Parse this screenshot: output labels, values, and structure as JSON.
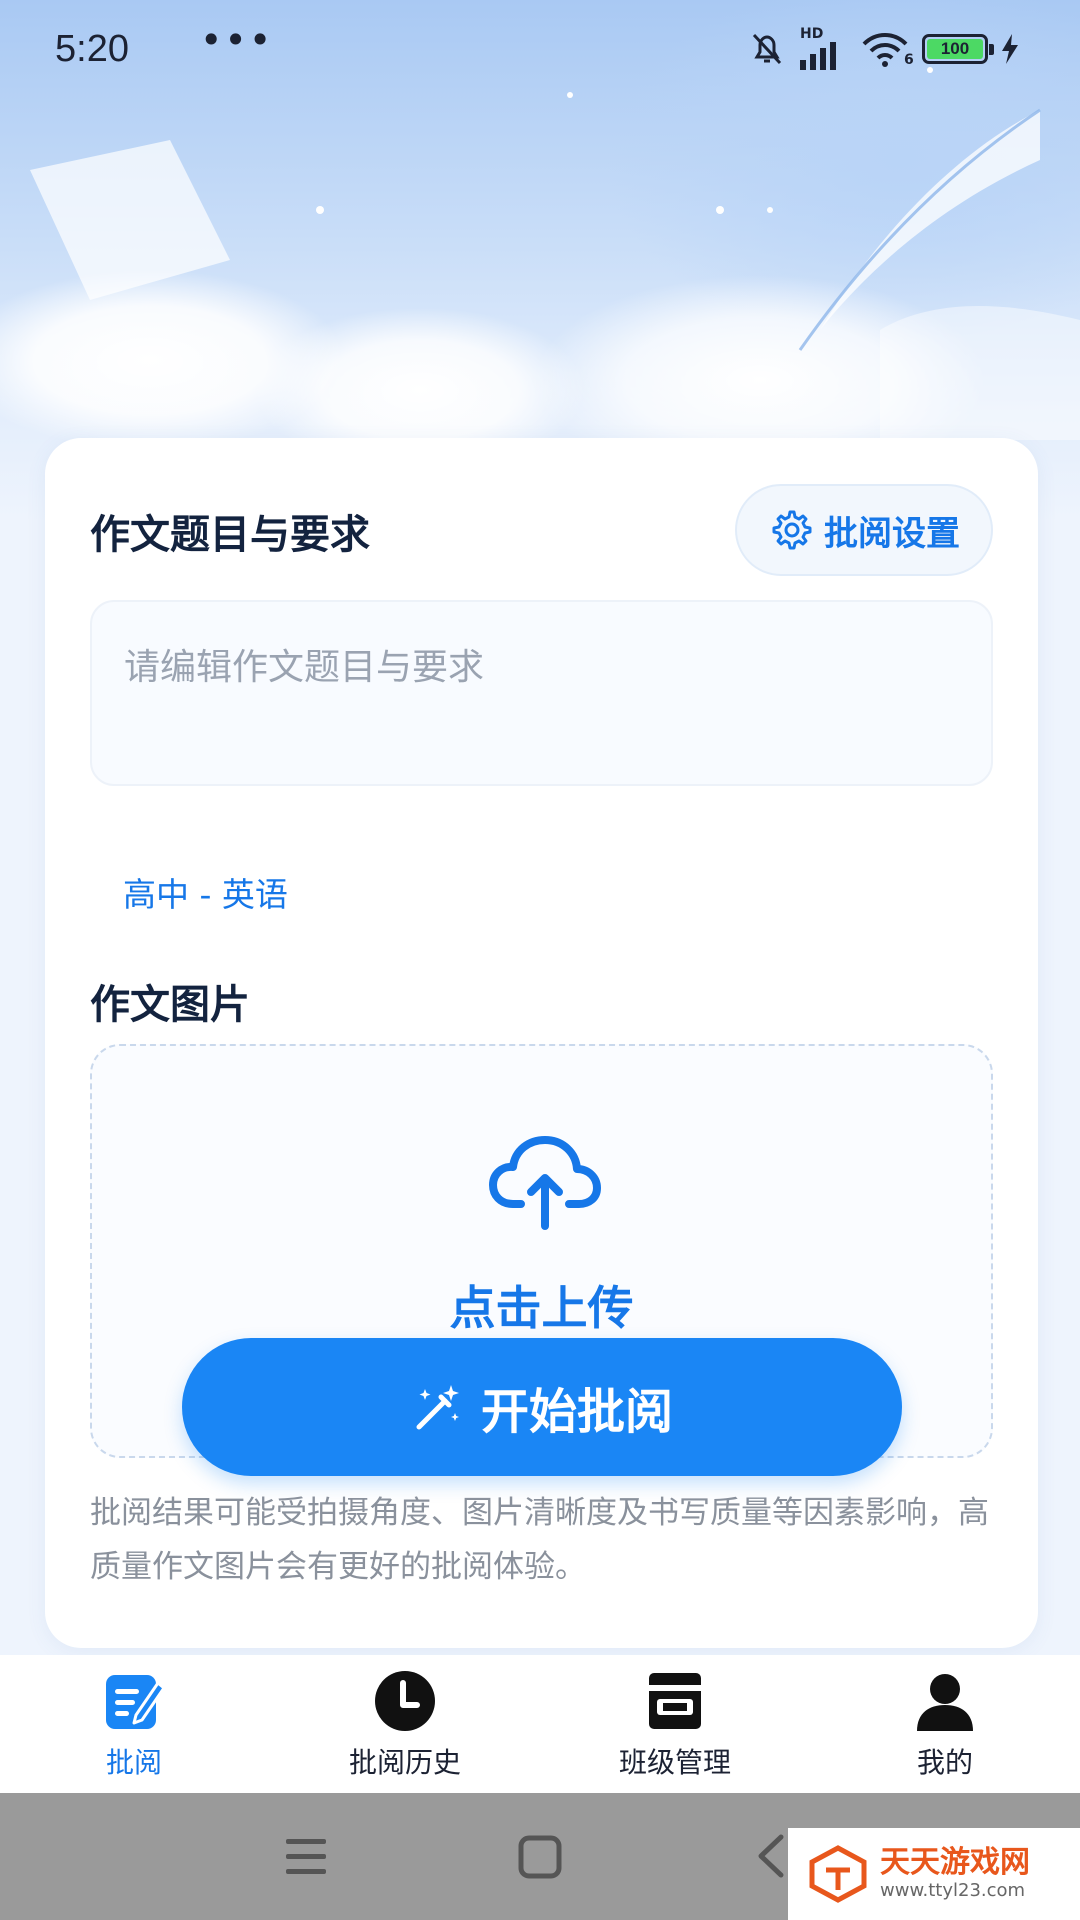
{
  "status_bar": {
    "time": "5:20",
    "more_dots": "•••",
    "network_label": "HD",
    "wifi_generation": "6",
    "battery_level": "100"
  },
  "composition": {
    "topic_title": "作文题目与要求",
    "settings_button": "批阅设置",
    "topic_placeholder": "请编辑作文题目与要求",
    "level_tag": "高中 - 英语",
    "image_title": "作文图片",
    "upload_label": "点击上传",
    "start_button": "开始批阅",
    "note": "批阅结果可能受拍摄角度、图片清晰度及书写质量等因素影响，高质量作文图片会有更好的批阅体验。"
  },
  "tabbar": {
    "items": [
      {
        "label": "批阅",
        "icon": "review-edit-icon",
        "active": true
      },
      {
        "label": "批阅历史",
        "icon": "clock-icon",
        "active": false
      },
      {
        "label": "班级管理",
        "icon": "class-manage-icon",
        "active": false
      },
      {
        "label": "我的",
        "icon": "person-icon",
        "active": false
      }
    ]
  },
  "watermark": {
    "title": "天天游戏网",
    "url": "www.ttyl23.com"
  },
  "colors": {
    "accent": "#1677e8",
    "button": "#1a86f5",
    "title_text": "#13233f",
    "muted_text": "#8a919c"
  }
}
